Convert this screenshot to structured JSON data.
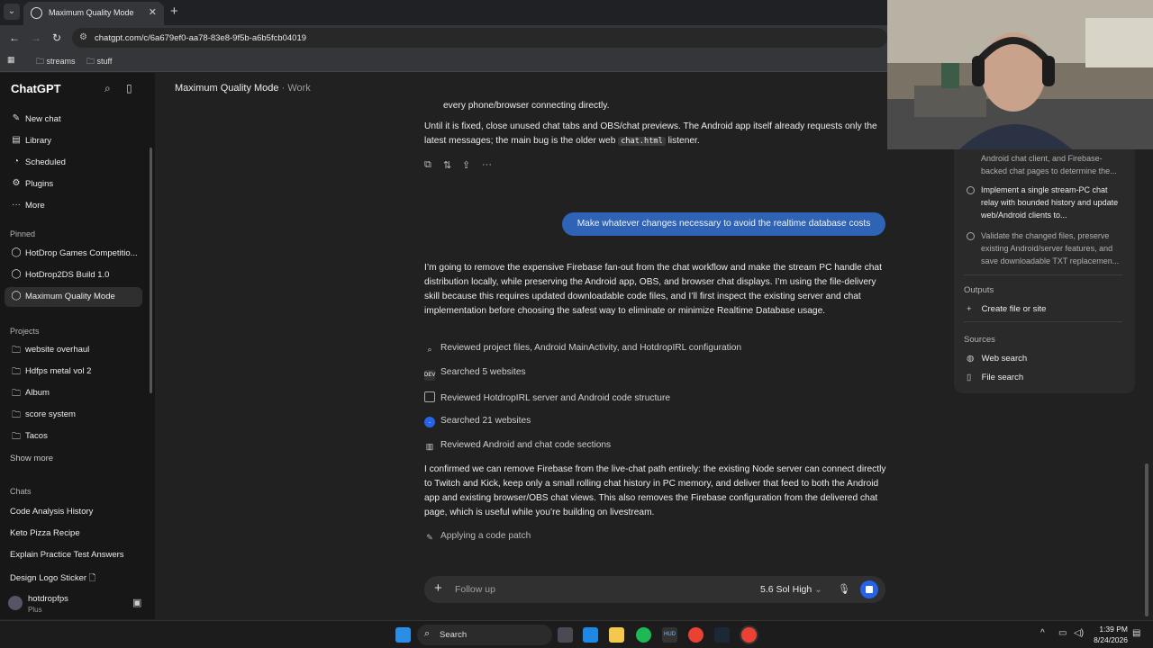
{
  "browser": {
    "tab_title": "Maximum Quality Mode",
    "url": "chatgpt.com/c/6a679ef0-aa78-83e8-9f5b-a6b5fcb04019",
    "bookmarks": [
      "streams",
      "stuff"
    ]
  },
  "sidebar": {
    "brand": "ChatGPT",
    "nav": [
      {
        "label": "New chat",
        "icon": "edit-icon"
      },
      {
        "label": "Library",
        "icon": "library-icon"
      },
      {
        "label": "Scheduled",
        "icon": "clock-icon"
      },
      {
        "label": "Plugins",
        "icon": "plugins-icon"
      },
      {
        "label": "More",
        "icon": "more-icon"
      }
    ],
    "pinned_heading": "Pinned",
    "pinned": [
      "HotDrop Games Competitio...",
      "HotDrop2DS Build 1.0",
      "Maximum Quality Mode"
    ],
    "projects_heading": "Projects",
    "projects": [
      "website overhaul",
      "Hdfps metal vol 2",
      "Album",
      "score system",
      "Tacos"
    ],
    "show_more": "Show more",
    "chats_heading": "Chats",
    "chats": [
      "Code Analysis History",
      "Keto Pizza Recipe",
      "Explain Practice Test Answers",
      "Design Logo Sticker 🗋"
    ],
    "user": {
      "name": "hotdropfps",
      "plan": "Plus"
    }
  },
  "main": {
    "title": "Maximum Quality Mode",
    "subtitle": "Work",
    "separator": "·",
    "msg_top_line": "every phone/browser connecting directly.",
    "msg_fix_a": "Until it is fixed, close unused chat tabs and OBS/chat previews. The Android app itself already requests only the latest messages; the main bug is the older web ",
    "msg_fix_code": "chat.html",
    "msg_fix_b": " listener.",
    "user_msg": "Make whatever changes necessary to avoid the realtime database costs",
    "reply_intro": "I’m going to remove the expensive Firebase fan-out from the chat workflow and make the stream PC handle chat distribution locally, while preserving the Android app, OBS, and browser chat displays. I’m using the file-delivery skill because this requires updated downloadable code files, and I’ll first inspect the existing server and chat implementation before choosing the safest way to eliminate or minimize Realtime Database usage.",
    "steps": [
      {
        "label": "Reviewed project files, Android MainActivity, and HotdropIRL configuration",
        "icon": "search-icon"
      },
      {
        "label": "Searched 5 websites",
        "icon": "dev-badge"
      },
      {
        "label": "Reviewed HotdropIRL server and Android code structure",
        "icon": "file-icon"
      },
      {
        "label": "Searched 21 websites",
        "icon": "globe-badge"
      },
      {
        "label": "Reviewed Android and chat code sections",
        "icon": "book-icon"
      }
    ],
    "reply_confirm": "I confirmed we can remove Firebase from the live-chat path entirely: the existing Node server can connect directly to Twitch and Kick, keep only a small rolling chat history in PC memory, and deliver that feed to both the Android app and existing browser/OBS chat views. This also removes the Firebase configuration from the delivered chat page, which is useful while you’re building on livestream.",
    "applying": "Applying a code patch",
    "composer": {
      "placeholder": "Follow up",
      "model": "5.6 Sol",
      "mode": "High"
    }
  },
  "panel": {
    "task_partial": "Android chat client, and Firebase-backed chat pages to determine the...",
    "tasks": [
      "Implement a single stream-PC chat relay with bounded history and update web/Android clients to...",
      "Validate the changed files, preserve existing Android/server features, and save downloadable TXT replacemen..."
    ],
    "outputs_heading": "Outputs",
    "create_file": "Create file or site",
    "sources_heading": "Sources",
    "sources": [
      "Web search",
      "File search"
    ]
  },
  "taskbar": {
    "search": "Search",
    "time": "1:39 PM",
    "date": "8/24/2026"
  },
  "colors": {
    "bg": "#212121",
    "sidebar": "#171717",
    "user_bubble": "#2e63b5",
    "stop_button": "#2563eb"
  }
}
